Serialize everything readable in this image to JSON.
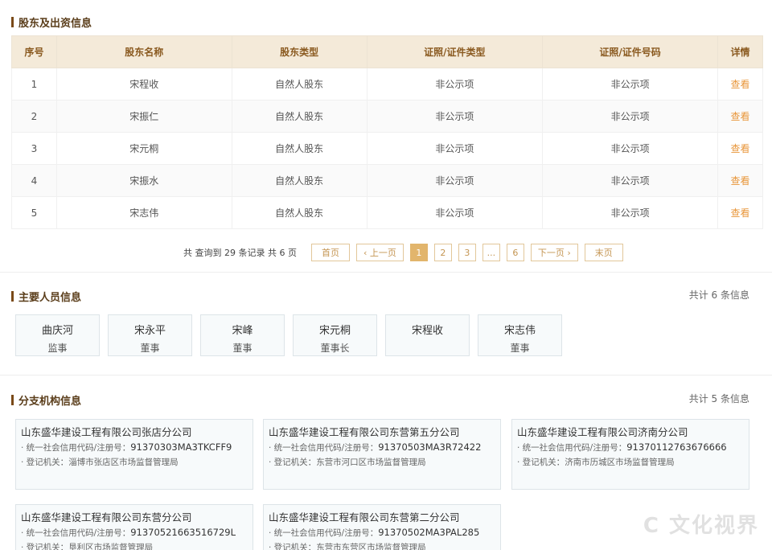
{
  "shareholders": {
    "title": "股东及出资信息",
    "headers": [
      "序号",
      "股东名称",
      "股东类型",
      "证照/证件类型",
      "证照/证件号码",
      "详情"
    ],
    "rows": [
      {
        "no": "1",
        "name": "宋程收",
        "type": "自然人股东",
        "cert_type": "非公示项",
        "cert_no": "非公示项",
        "detail": "查看"
      },
      {
        "no": "2",
        "name": "宋振仁",
        "type": "自然人股东",
        "cert_type": "非公示项",
        "cert_no": "非公示项",
        "detail": "查看"
      },
      {
        "no": "3",
        "name": "宋元桐",
        "type": "自然人股东",
        "cert_type": "非公示项",
        "cert_no": "非公示项",
        "detail": "查看"
      },
      {
        "no": "4",
        "name": "宋振水",
        "type": "自然人股东",
        "cert_type": "非公示项",
        "cert_no": "非公示项",
        "detail": "查看"
      },
      {
        "no": "5",
        "name": "宋志伟",
        "type": "自然人股东",
        "cert_type": "非公示项",
        "cert_no": "非公示项",
        "detail": "查看"
      }
    ]
  },
  "pagination": {
    "summary": "共 查询到 29 条记录 共 6 页",
    "first": "首页",
    "prev": "‹ 上一页",
    "pages": [
      "1",
      "2",
      "3",
      "...",
      "6"
    ],
    "active_page": "1",
    "next": "下一页 ›",
    "last": "末页"
  },
  "personnel": {
    "title": "主要人员信息",
    "count": "共计 6 条信息",
    "people": [
      {
        "name": "曲庆河",
        "role": "监事"
      },
      {
        "name": "宋永平",
        "role": "董事"
      },
      {
        "name": "宋峰",
        "role": "董事"
      },
      {
        "name": "宋元桐",
        "role": "董事长"
      },
      {
        "name": "宋程收",
        "role": ""
      },
      {
        "name": "宋志伟",
        "role": "董事"
      }
    ]
  },
  "branches": {
    "title": "分支机构信息",
    "count": "共计 5 条信息",
    "code_label": "· 统一社会信用代码/注册号：",
    "authority_label": "· 登记机关：",
    "items": [
      {
        "name": "山东盛华建设工程有限公司张店分公司",
        "code": "91370303MA3TKCFF9",
        "authority": "淄博市张店区市场监督管理局"
      },
      {
        "name": "山东盛华建设工程有限公司东营第五分公司",
        "code": "91370503MA3R72422",
        "authority": "东营市河口区市场监督管理局"
      },
      {
        "name": "山东盛华建设工程有限公司济南分公司",
        "code": "91370112763676666",
        "authority": "济南市历城区市场监督管理局"
      },
      {
        "name": "山东盛华建设工程有限公司东营分公司",
        "code": "91370521663516729L",
        "authority": "垦利区市场监督管理局"
      },
      {
        "name": "山东盛华建设工程有限公司东营第二分公司",
        "code": "91370502MA3PAL285",
        "authority": "东营市东营区市场监督管理局"
      }
    ]
  },
  "watermark": "C 文化视界"
}
